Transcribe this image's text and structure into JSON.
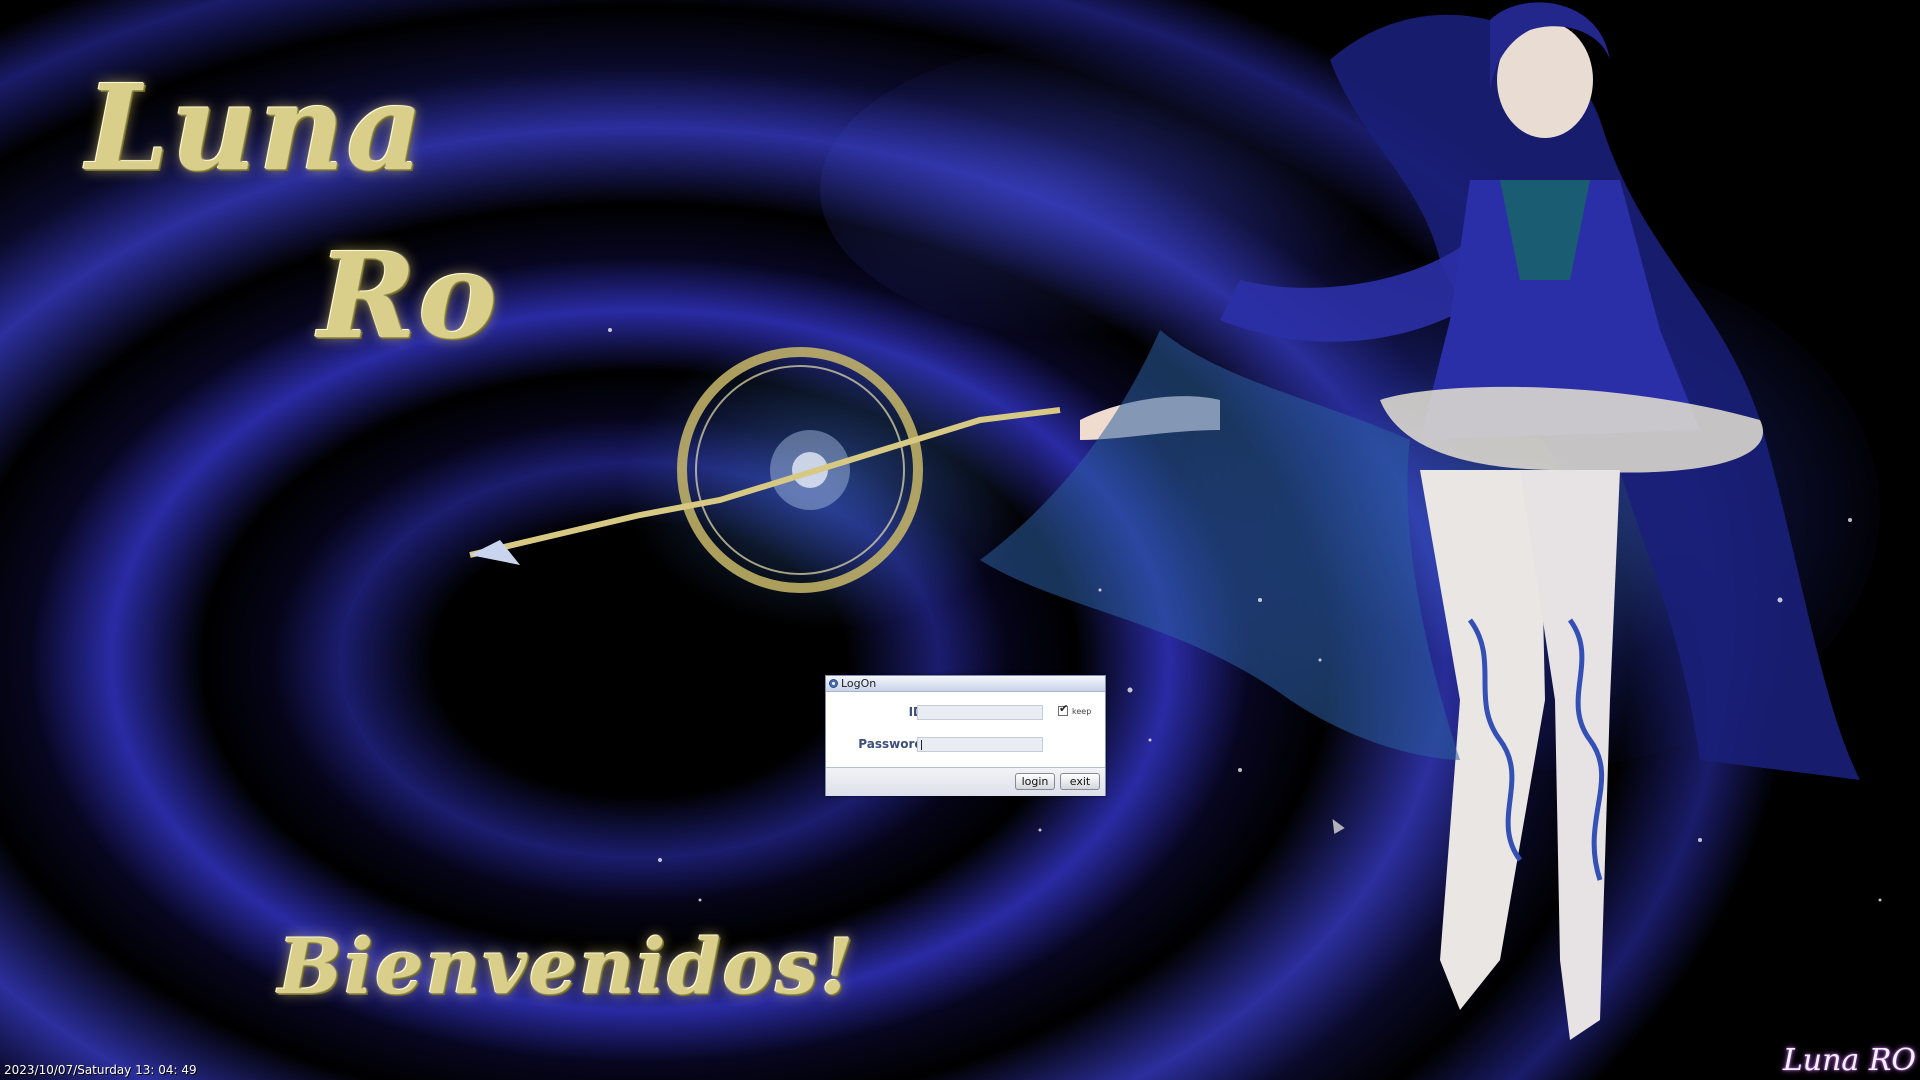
{
  "title_logo": {
    "line1": "Luna",
    "line2": "Ro"
  },
  "welcome_text": "Bienvenidos!",
  "login_window": {
    "title": "LogOn",
    "id_label": "ID",
    "id_value": "",
    "password_label": "Password",
    "password_value": "",
    "keep_label": "keep",
    "keep_checked": true,
    "login_label": "login",
    "exit_label": "exit"
  },
  "status_bar": {
    "clock": "2023/10/07/Saturday  13: 04: 49"
  },
  "brand_watermark": "Luna RO",
  "colors": {
    "background": "#02020a",
    "swirl_blue": "#2a2ba4",
    "title_gold": "#d9cf8a",
    "label_blue": "#3c4f7c"
  },
  "icons": {
    "window_icon": "circle-window-icon",
    "mouse_cursor": "arrow-cursor-icon"
  }
}
